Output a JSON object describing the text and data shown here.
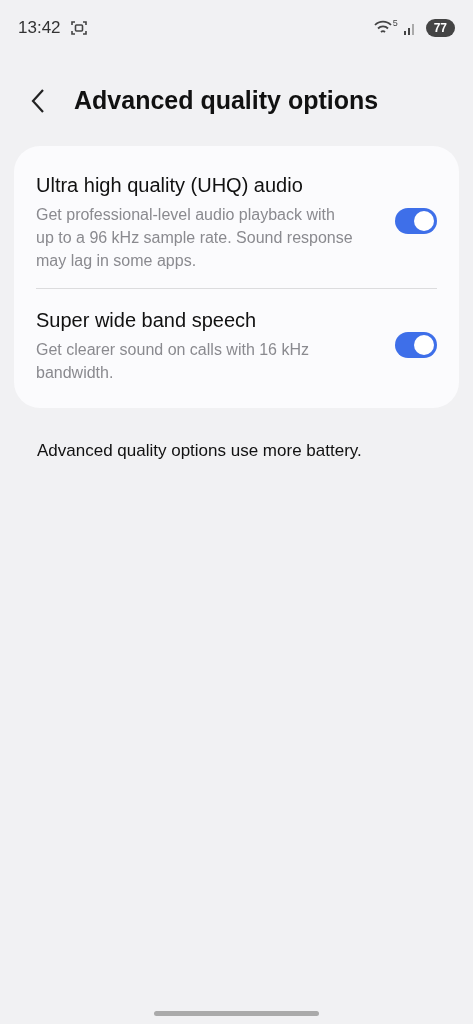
{
  "status_bar": {
    "time": "13:42",
    "wifi_badge": "5",
    "battery": "77"
  },
  "header": {
    "title": "Advanced quality options"
  },
  "settings": [
    {
      "title": "Ultra high quality (UHQ) audio",
      "description": "Get professional-level audio playback with up to a 96 kHz sample rate. Sound response may lag in some apps.",
      "on": true
    },
    {
      "title": "Super wide band speech",
      "description": "Get clearer sound on calls with 16 kHz bandwidth.",
      "on": true
    }
  ],
  "footnote": "Advanced quality options use more battery."
}
